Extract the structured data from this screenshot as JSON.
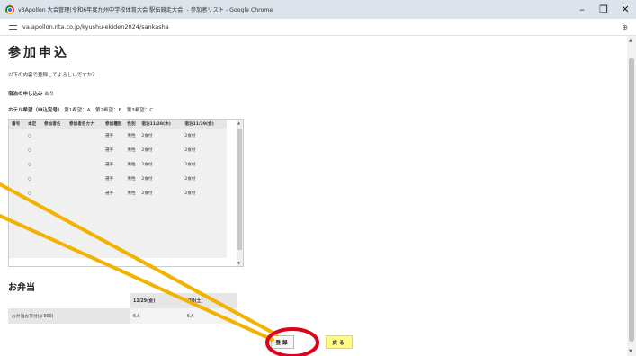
{
  "browser": {
    "window_title": "v3Apollon 大会管理(令和6年度九州中学校体育大会 駅伝競走大会) - 参加者リスト - Google Chrome",
    "url": "va.apollon.nta.co.jp/kyushu-ekiden2024/sankasha",
    "minimize": "–",
    "maximize": "❐",
    "close": "✕",
    "zoom_glyph": "⊕"
  },
  "page": {
    "title": "参加申込",
    "confirm_text": "以下の内容で登録してよろしいですか？",
    "road_label": "宿泊の申し込み",
    "road_value": "あり",
    "hotel_label": "ホテル希望（申込定号）",
    "hotel_value": "第1希望：A　第2希望：B　第3希望：C"
  },
  "participants": {
    "headers": [
      "番号",
      "本定",
      "参加者名",
      "参加者名カナ",
      "参加種別",
      "性別",
      "宿泊11/28(木)",
      "宿泊11/29(金)"
    ],
    "rows": [
      [
        "",
        "○",
        "",
        "",
        "選手",
        "男性",
        "2食付",
        "2食付"
      ],
      [
        "",
        "○",
        "",
        "",
        "選手",
        "男性",
        "2食付",
        "2食付"
      ],
      [
        "",
        "○",
        "",
        "",
        "選手",
        "男性",
        "2食付",
        "2食付"
      ],
      [
        "",
        "○",
        "",
        "",
        "選手",
        "男性",
        "2食付",
        "2食付"
      ],
      [
        "",
        "○",
        "",
        "",
        "選手",
        "男性",
        "2食付",
        "2食付"
      ]
    ]
  },
  "bento": {
    "heading": "お弁当",
    "col1": "11/29(金)",
    "col2": "/30(土)",
    "row_label": "お弁当お茶付(￥900)",
    "val1": "5人",
    "val2": "5人"
  },
  "buttons": {
    "register": "登録",
    "back": "戻る"
  },
  "colors": {
    "annotation_line": "#f2b200",
    "annotation_circle": "#e0001a",
    "back_button": "#fff98a"
  }
}
